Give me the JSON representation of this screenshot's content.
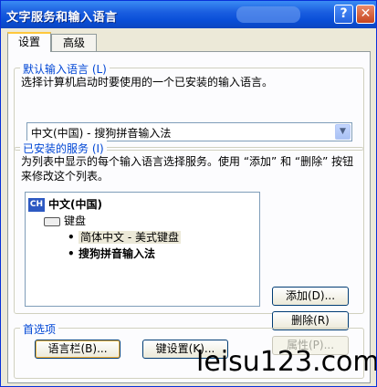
{
  "window": {
    "title": "文字服务和输入语言",
    "help_glyph": "?",
    "close_glyph": "✕"
  },
  "tabs": [
    {
      "label": "设置"
    },
    {
      "label": "高级"
    }
  ],
  "default_lang": {
    "group_label": "默认输入语言 (L)",
    "description": "选择计算机启动时要使用的一个已安装的输入语言。",
    "selected": "中文(中国) - 搜狗拼音输入法"
  },
  "installed": {
    "group_label": "已安装的服务 (I)",
    "description": "为列表中显示的每个输入语言选择服务。使用 “添加” 和 “删除” 按钮来修改这个列表。",
    "tree": {
      "lang_badge": "CH",
      "language": "中文(中国)",
      "category": "键盘",
      "items": [
        "简体中文 - 美式键盘",
        "搜狗拼音输入法"
      ]
    },
    "add_label": "添加(D)...",
    "remove_label": "删除(R)",
    "props_label": "属性(P)..."
  },
  "prefs": {
    "group_label": "首选项",
    "langbar_label": "语言栏(B)...",
    "keys_label": "键设置(K)..."
  },
  "watermark": "leisu123.com"
}
